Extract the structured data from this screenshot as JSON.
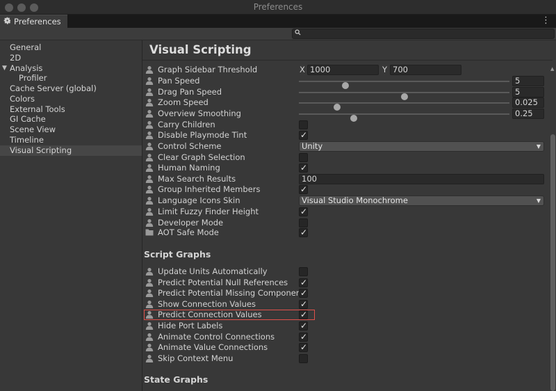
{
  "window": {
    "title": "Preferences",
    "tab_label": "Preferences"
  },
  "search": {
    "placeholder": "",
    "value": ""
  },
  "sidebar": {
    "items": [
      {
        "label": "General",
        "selected": false
      },
      {
        "label": "2D",
        "selected": false
      },
      {
        "label": "Analysis",
        "selected": false,
        "expanded": true
      },
      {
        "label": "Profiler",
        "selected": false,
        "indent": true
      },
      {
        "label": "Cache Server (global)",
        "selected": false
      },
      {
        "label": "Colors",
        "selected": false
      },
      {
        "label": "External Tools",
        "selected": false
      },
      {
        "label": "GI Cache",
        "selected": false
      },
      {
        "label": "Scene View",
        "selected": false
      },
      {
        "label": "Timeline",
        "selected": false
      },
      {
        "label": "Visual Scripting",
        "selected": true
      }
    ]
  },
  "main": {
    "title": "Visual Scripting",
    "general": {
      "graph_sidebar_threshold": {
        "label": "Graph Sidebar Threshold",
        "x_label": "X",
        "x_value": "1000",
        "y_label": "Y",
        "y_value": "700"
      },
      "pan_speed": {
        "label": "Pan Speed",
        "value": "5",
        "slider_fraction": 0.22
      },
      "drag_pan_speed": {
        "label": "Drag Pan Speed",
        "value": "5",
        "slider_fraction": 0.5
      },
      "zoom_speed": {
        "label": "Zoom Speed",
        "value": "0.025",
        "slider_fraction": 0.18
      },
      "overview_smoothing": {
        "label": "Overview Smoothing",
        "value": "0.25",
        "slider_fraction": 0.26
      },
      "carry_children": {
        "label": "Carry Children",
        "checked": false
      },
      "disable_playmode_tint": {
        "label": "Disable Playmode Tint",
        "checked": true
      },
      "control_scheme": {
        "label": "Control Scheme",
        "value": "Unity"
      },
      "clear_graph_selection": {
        "label": "Clear Graph Selection",
        "checked": false
      },
      "human_naming": {
        "label": "Human Naming",
        "checked": true
      },
      "max_search_results": {
        "label": "Max Search Results",
        "value": "100"
      },
      "group_inherited_members": {
        "label": "Group Inherited Members",
        "checked": true
      },
      "language_icons_skin": {
        "label": "Language Icons Skin",
        "value": "Visual Studio Monochrome"
      },
      "limit_fuzzy_finder_height": {
        "label": "Limit Fuzzy Finder Height",
        "checked": true
      },
      "developer_mode": {
        "label": "Developer Mode",
        "checked": false
      },
      "aot_safe_mode": {
        "label": "AOT Safe Mode",
        "checked": true
      }
    },
    "script_graphs": {
      "heading": "Script Graphs",
      "items": [
        {
          "label": "Update Units Automatically",
          "checked": false
        },
        {
          "label": "Predict Potential Null References",
          "checked": true
        },
        {
          "label": "Predict Potential Missing Components",
          "checked": true
        },
        {
          "label": "Show Connection Values",
          "checked": true
        },
        {
          "label": "Predict Connection Values",
          "checked": true,
          "highlighted": true
        },
        {
          "label": "Hide Port Labels",
          "checked": true
        },
        {
          "label": "Animate Control Connections",
          "checked": true
        },
        {
          "label": "Animate Value Connections",
          "checked": true
        },
        {
          "label": "Skip Context Menu",
          "checked": false
        }
      ]
    },
    "state_graphs": {
      "heading": "State Graphs"
    }
  },
  "colors": {
    "highlight_border": "#e0514b",
    "panel_bg": "#383838",
    "field_bg": "#2a2a2a"
  },
  "icons": {
    "settings_tab": "gear-icon",
    "search": "search-icon",
    "menu": "kebab-menu-icon",
    "user_scope": "person-icon",
    "project_scope": "folder-icon"
  }
}
